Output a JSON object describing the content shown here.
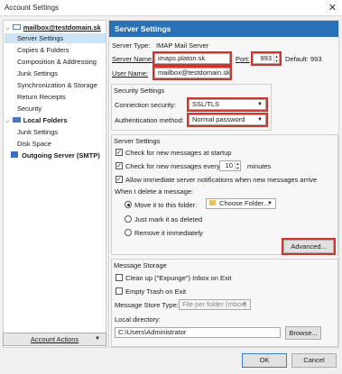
{
  "window": {
    "title": "Account Settings",
    "close": "✕"
  },
  "sidebar": {
    "account": "mailbox@testdomain.sk",
    "account_items": [
      "Server Settings",
      "Copies & Folders",
      "Composition & Addressing",
      "Junk Settings",
      "Synchronization & Storage",
      "Return Receipts",
      "Security"
    ],
    "local_folders": "Local Folders",
    "local_items": [
      "Junk Settings",
      "Disk Space"
    ],
    "outgoing": "Outgoing Server (SMTP)",
    "account_actions": "Account Actions"
  },
  "main": {
    "header": "Server Settings",
    "server_type_label": "Server Type:",
    "server_type_value": "IMAP Mail Server",
    "server_name_label": "Server Name:",
    "server_name_value": "imaps.platon.sk",
    "port_label": "Port:",
    "port_value": "993",
    "default_label": "Default:",
    "default_value": "993",
    "user_name_label": "User Name:",
    "user_name_value": "mailbox@testdomain.sk",
    "security_settings": "Security Settings",
    "connection_security_label": "Connection security:",
    "connection_security_value": "SSL/TLS",
    "auth_method_label": "Authentication method:",
    "auth_method_value": "Normal password",
    "server_settings_group": "Server Settings",
    "check_startup": "Check for new messages at startup",
    "check_every": "Check for new messages every",
    "check_every_value": "10",
    "minutes": "minutes",
    "allow_immediate": "Allow immediate server notifications when new messages arrive",
    "when_delete": "When I delete a message:",
    "move_to_folder": "Move it to this folder:",
    "choose_folder": "Choose Folder...",
    "just_mark": "Just mark it as deleted",
    "remove_immediately": "Remove it immediately",
    "advanced": "Advanced...",
    "message_storage": "Message Storage",
    "clean_up": "Clean up (\"Expunge\") Inbox on Exit",
    "empty_trash": "Empty Trash on Exit",
    "store_type_label": "Message Store Type:",
    "store_type_value": "File per folder (mbox)",
    "local_directory_label": "Local directory:",
    "local_directory_value": "C:\\Users\\Administrator",
    "browse": "Browse..."
  },
  "footer": {
    "ok": "OK",
    "cancel": "Cancel"
  }
}
